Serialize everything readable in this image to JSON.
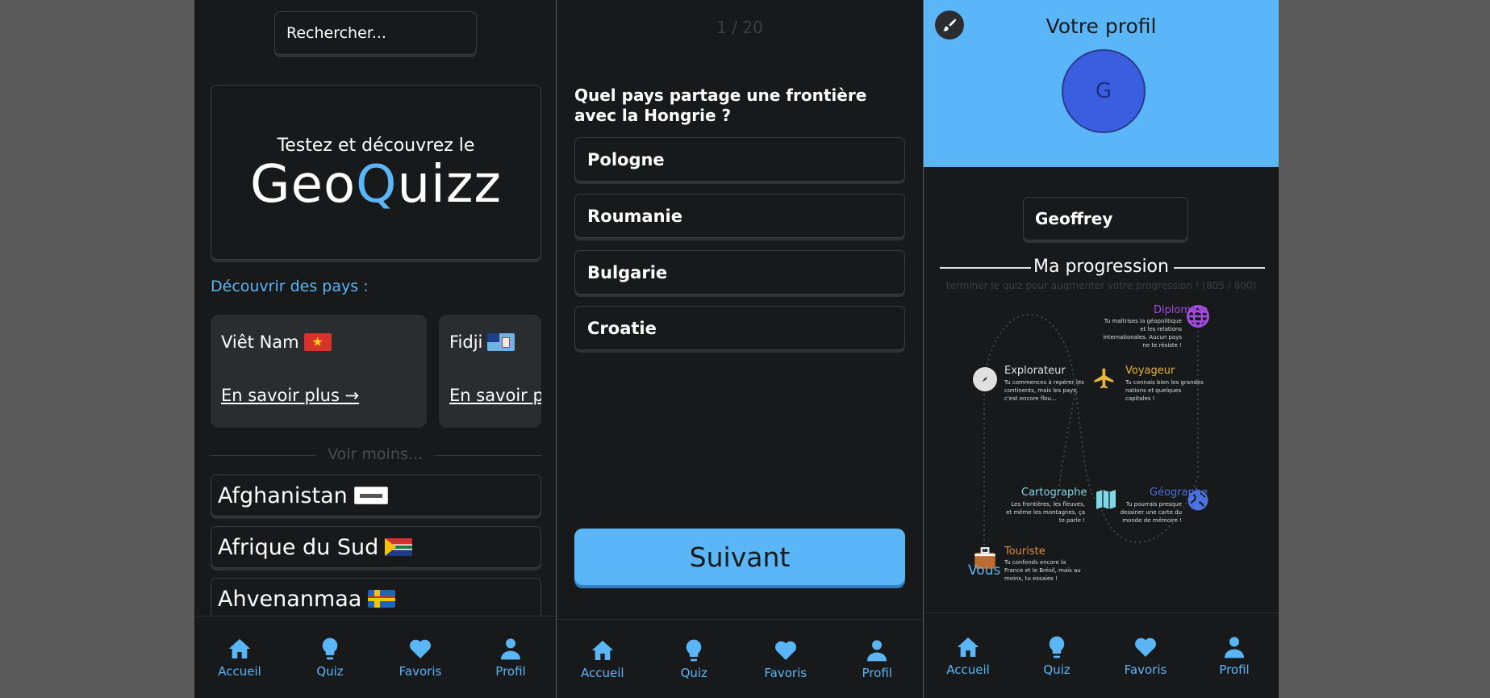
{
  "nav": {
    "home": "Accueil",
    "quiz": "Quiz",
    "favorites": "Favoris",
    "profile": "Profil"
  },
  "home": {
    "search_placeholder": "Rechercher...",
    "hero_subtitle": "Testez et découvrez le",
    "hero_logo_start": "Geo",
    "hero_logo_q": "Q",
    "hero_logo_end": "uizz",
    "discover_label": "Découvrir des pays :",
    "cards": [
      {
        "name": "Viêt Nam",
        "more": "En savoir plus →"
      },
      {
        "name": "Fidji",
        "more": "En savoir plus →"
      }
    ],
    "see_less": "Voir moins...",
    "countries": [
      "Afghanistan",
      "Afrique du Sud",
      "Ahvenanmaa"
    ]
  },
  "quiz": {
    "counter": "1 / 20",
    "question": "Quel pays partage une frontière avec la Hongrie ?",
    "answers": [
      "Pologne",
      "Roumanie",
      "Bulgarie",
      "Croatie"
    ],
    "next_label": "Suivant"
  },
  "profile": {
    "title": "Votre profil",
    "avatar_letter": "G",
    "username": "Geoffrey",
    "progress_title": "Ma progression",
    "progress_subtitle": "terminer le quiz pour augmenter votre progression ! (805 / 800)",
    "you_label": "Vous",
    "badges": [
      {
        "title": "Diplomate",
        "desc": "Tu maîtrises la géopolitique et les relations internationales. Aucun pays ne te résiste !",
        "color": "#a24ce0"
      },
      {
        "title": "Explorateur",
        "desc": "Tu commences à repérer les continents, mais les pays, c'est encore flou...",
        "color": "#e0e0e0"
      },
      {
        "title": "Voyageur",
        "desc": "Tu connais bien les grandes nations et quelques capitales !",
        "color": "#e8b43a"
      },
      {
        "title": "Cartographe",
        "desc": "Les frontières, les fleuves, et même les montagnes, ça te parle !",
        "color": "#7fd8e8"
      },
      {
        "title": "Géographe",
        "desc": "Tu pourrais presque dessiner une carte du monde de mémoire !",
        "color": "#4a72e0"
      },
      {
        "title": "Touriste",
        "desc": "Tu confonds encore la France et le Brésil, mais au moins, tu essaies !",
        "color": "#e08a3a"
      }
    ]
  }
}
